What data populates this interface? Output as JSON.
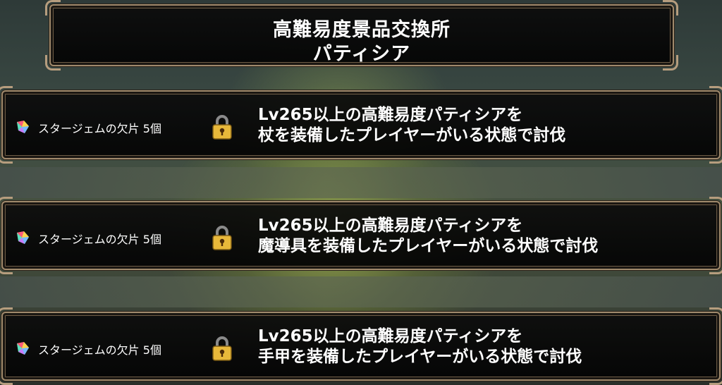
{
  "header": {
    "title": "高難易度景品交換所",
    "subtitle": "パティシア"
  },
  "rewards": [
    {
      "item_icon": "star-gem-fragment-icon",
      "item_label": "スタージェムの欠片  5個",
      "status_icon": "padlock-icon",
      "condition_line1": "Lv265以上の高難易度パティシアを",
      "condition_line2": "杖を装備したプレイヤーがいる状態で討伐"
    },
    {
      "item_icon": "star-gem-fragment-icon",
      "item_label": "スタージェムの欠片  5個",
      "status_icon": "padlock-icon",
      "condition_line1": "Lv265以上の高難易度パティシアを",
      "condition_line2": "魔導具を装備したプレイヤーがいる状態で討伐"
    },
    {
      "item_icon": "star-gem-fragment-icon",
      "item_label": "スタージェムの欠片  5個",
      "status_icon": "padlock-icon",
      "condition_line1": "Lv265以上の高難易度パティシアを",
      "condition_line2": "手甲を装備したプレイヤーがいる状態で討伐"
    }
  ],
  "colors": {
    "frame_border": "#a08a6c",
    "lock_gold": "#e8b83a",
    "text": "#ffffff"
  }
}
